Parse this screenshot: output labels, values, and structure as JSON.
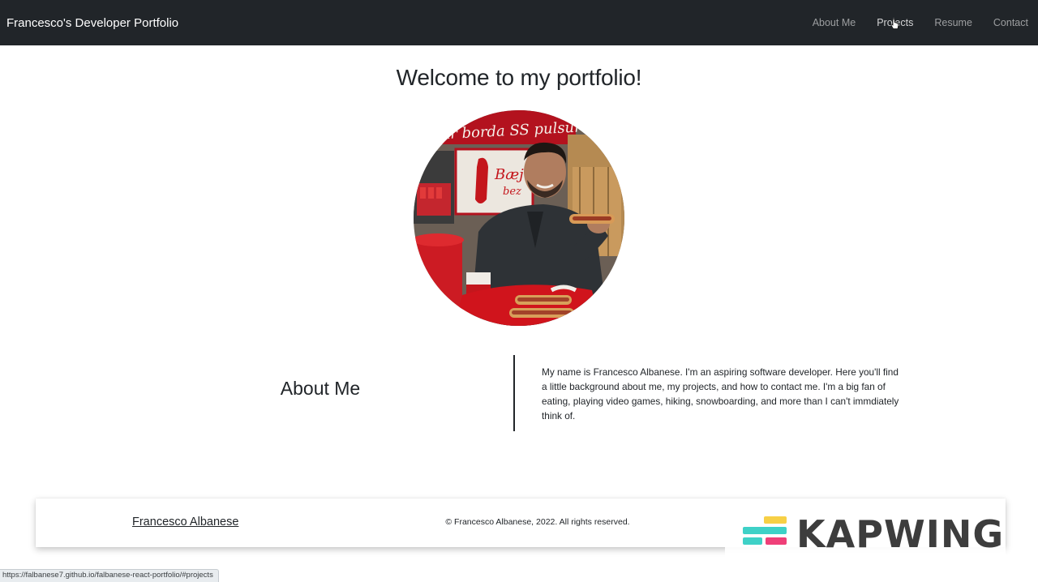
{
  "nav": {
    "brand": "Francesco's Developer Portfolio",
    "links": [
      {
        "label": "About Me"
      },
      {
        "label": "Projects"
      },
      {
        "label": "Resume"
      },
      {
        "label": "Contact"
      }
    ]
  },
  "main": {
    "welcome": "Welcome to my portfolio!",
    "avatar_alt": "Photo of Francesco holding a hot dog"
  },
  "about": {
    "heading": "About Me",
    "text": "My name is Francesco Albanese. I'm an aspiring software developer. Here you'll find a little background about me, my projects, and how to contact me. I'm a big fan of eating, playing video games, hiking, snowboarding, and more than I can't immdiately think of."
  },
  "footer": {
    "name": "Francesco Albanese",
    "copyright": "© Francesco Albanese, 2022. All rights reserved."
  },
  "watermark": {
    "text": "KAPWING"
  },
  "statusbar": {
    "url": "https://falbanese7.github.io/falbanese-react-portfolio/#projects"
  },
  "colors": {
    "navbar_bg": "#212529",
    "text": "#212529",
    "kapwing_yellow": "#f7d046",
    "kapwing_teal": "#3ed1c7",
    "kapwing_pink": "#ef3f78",
    "kapwing_dark": "#3d3d3d"
  }
}
